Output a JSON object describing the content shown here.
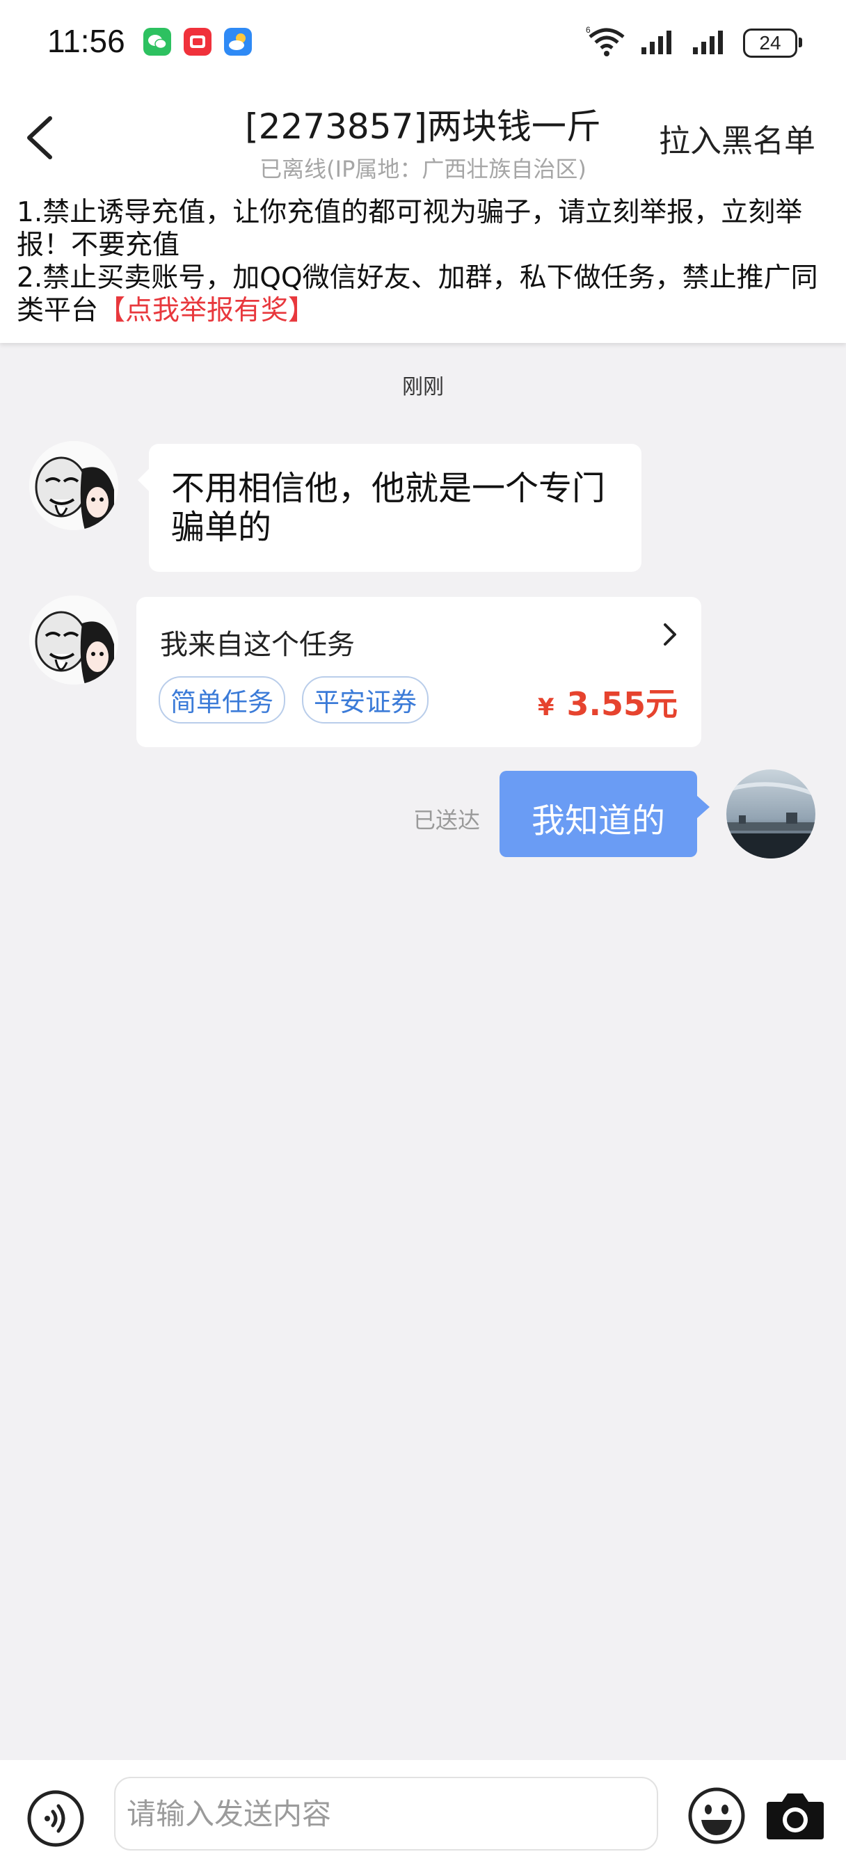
{
  "status_bar": {
    "time": "11:56",
    "battery": "24",
    "apps": [
      "wechat-icon",
      "red-app-icon",
      "weather-icon"
    ]
  },
  "header": {
    "title": "[2273857]两块钱一斤",
    "subtitle": "已离线(IP属地：广西壮族自治区)",
    "blacklist_label": "拉入黑名单"
  },
  "notice": {
    "line1": "1.禁止诱导充值，让你充值的都可视为骗子，请立刻举报，立刻举报！不要充值",
    "line2": "2.禁止买卖账号，加QQ微信好友、加群，私下做任务，禁止推广同类平台",
    "report_link": "【点我举报有奖】"
  },
  "chat": {
    "time_separator": "刚刚",
    "messages": [
      {
        "from": "other",
        "type": "text",
        "text": "不用相信他，他就是一个专门骗单的"
      },
      {
        "from": "other",
        "type": "task_card",
        "label": "我来自这个任务",
        "tags": [
          "简单任务",
          "平安证券"
        ],
        "currency": "¥",
        "price": "3.55元"
      },
      {
        "from": "me",
        "type": "text",
        "text": "我知道的",
        "status": "已送达"
      }
    ]
  },
  "input_bar": {
    "placeholder": "请输入发送内容"
  },
  "colors": {
    "accent_blue": "#6a9cf4",
    "price_red": "#e6432e",
    "report_red": "#e8383d",
    "tag_blue": "#3b7bd8",
    "background": "#f2f1f3"
  }
}
